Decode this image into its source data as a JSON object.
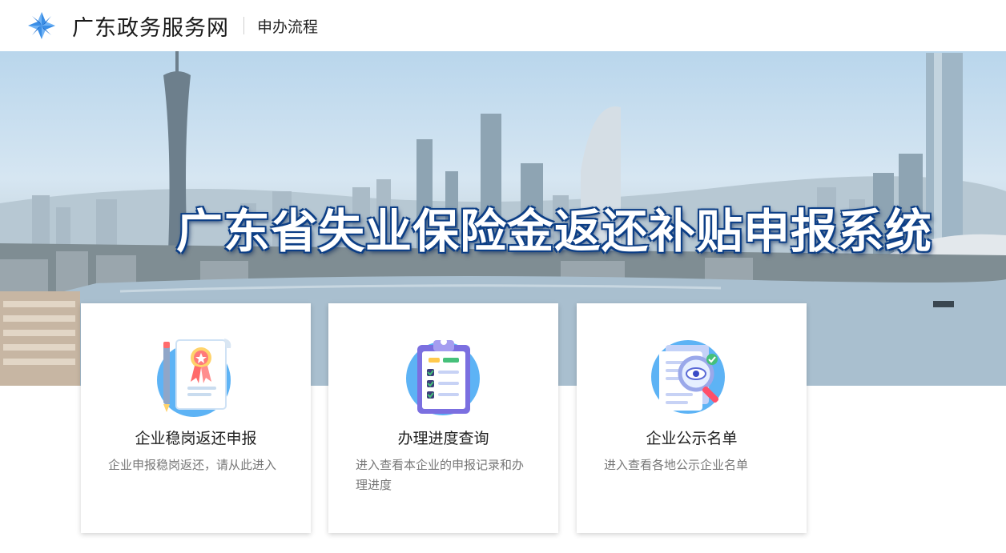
{
  "header": {
    "logo_icon": "guangdong-star-logo-icon",
    "site_title": "广东政务服务网",
    "sub_title": "申办流程"
  },
  "banner": {
    "title": "广东省失业保险金返还补贴申报系统"
  },
  "cards": [
    {
      "icon": "certificate-badge-icon",
      "title": "企业稳岗返还申报",
      "description": "企业申报稳岗返还，请从此进入"
    },
    {
      "icon": "clipboard-checklist-icon",
      "title": "办理进度查询",
      "description": "进入查看本企业的申报记录和办理进度"
    },
    {
      "icon": "document-search-icon",
      "title": "企业公示名单",
      "description": "进入查看各地公示企业名单"
    }
  ],
  "colors": {
    "brand_blue": "#2b7be0",
    "banner_title_outline": "#0d3f86"
  }
}
